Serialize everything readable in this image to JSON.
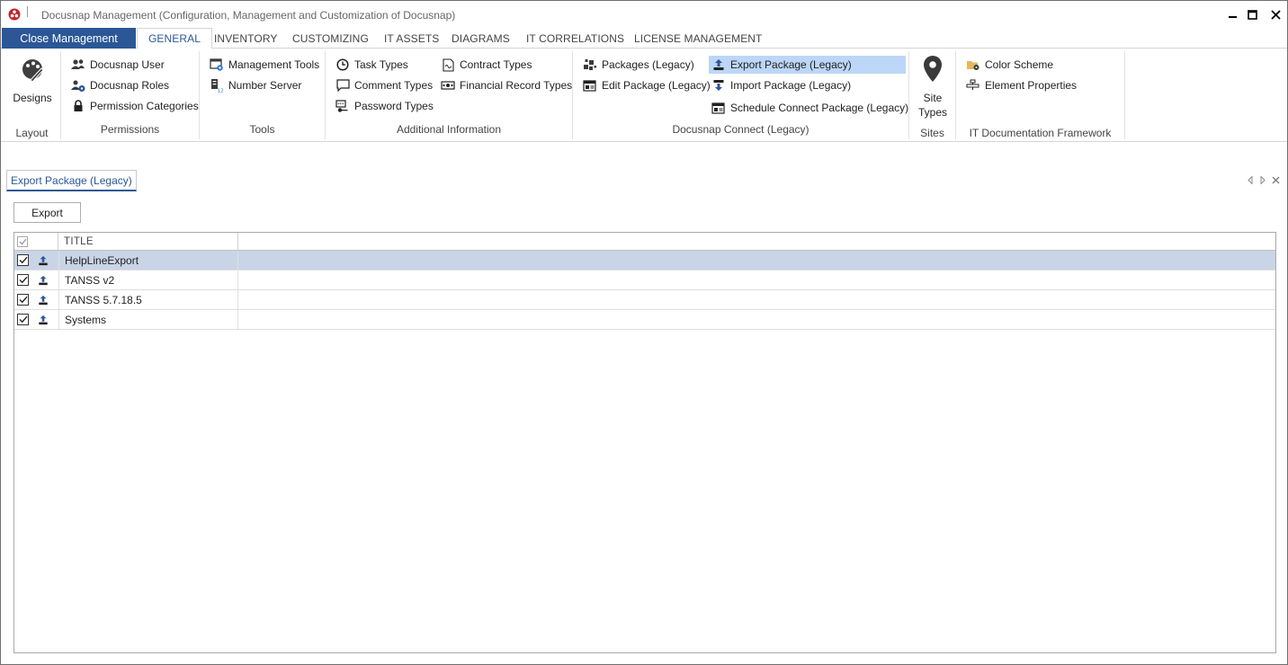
{
  "window": {
    "title": "Docusnap Management (Configuration, Management and Customization of Docusnap)"
  },
  "tabs": {
    "file_label": "Close Management",
    "items": [
      {
        "label": "GENERAL",
        "active": true
      },
      {
        "label": "INVENTORY"
      },
      {
        "label": "CUSTOMIZING"
      },
      {
        "label": "IT ASSETS"
      },
      {
        "label": "DIAGRAMS"
      },
      {
        "label": "IT CORRELATIONS"
      },
      {
        "label": "LICENSE MANAGEMENT"
      }
    ]
  },
  "ribbon": {
    "layout": {
      "label": "Layout",
      "designs": "Designs"
    },
    "permissions": {
      "label": "Permissions",
      "user": "Docusnap User",
      "roles": "Docusnap Roles",
      "categories": "Permission Categories"
    },
    "tools": {
      "label": "Tools",
      "management_tools": "Management Tools",
      "number_server": "Number Server"
    },
    "additional": {
      "label": "Additional Information",
      "task_types": "Task Types",
      "comment_types": "Comment Types",
      "password_types": "Password Types",
      "contract_types": "Contract Types",
      "financial_record_types": "Financial Record Types"
    },
    "connect": {
      "label": "Docusnap Connect (Legacy)",
      "packages": "Packages (Legacy)",
      "edit_package": "Edit Package (Legacy)",
      "export_package": "Export Package (Legacy)",
      "import_package": "Import Package (Legacy)",
      "schedule_package": "Schedule Connect Package (Legacy)"
    },
    "sites": {
      "label": "Sites",
      "site_types": "Site Types"
    },
    "framework": {
      "label": "IT Documentation Framework",
      "color_scheme": "Color Scheme",
      "element_properties": "Element Properties"
    }
  },
  "document": {
    "tab_label": "Export Package (Legacy)",
    "export_button": "Export"
  },
  "grid": {
    "columns": [
      "TITLE"
    ],
    "rows": [
      {
        "title": "HelpLineExport",
        "checked": true,
        "selected": true
      },
      {
        "title": "TANSS v2",
        "checked": true
      },
      {
        "title": "TANSS 5.7.18.5",
        "checked": true
      },
      {
        "title": "Systems",
        "checked": true
      }
    ]
  },
  "colors": {
    "accent": "#2b5797",
    "selection": "#bcd6f7",
    "row_selection": "#c9d5e6"
  }
}
